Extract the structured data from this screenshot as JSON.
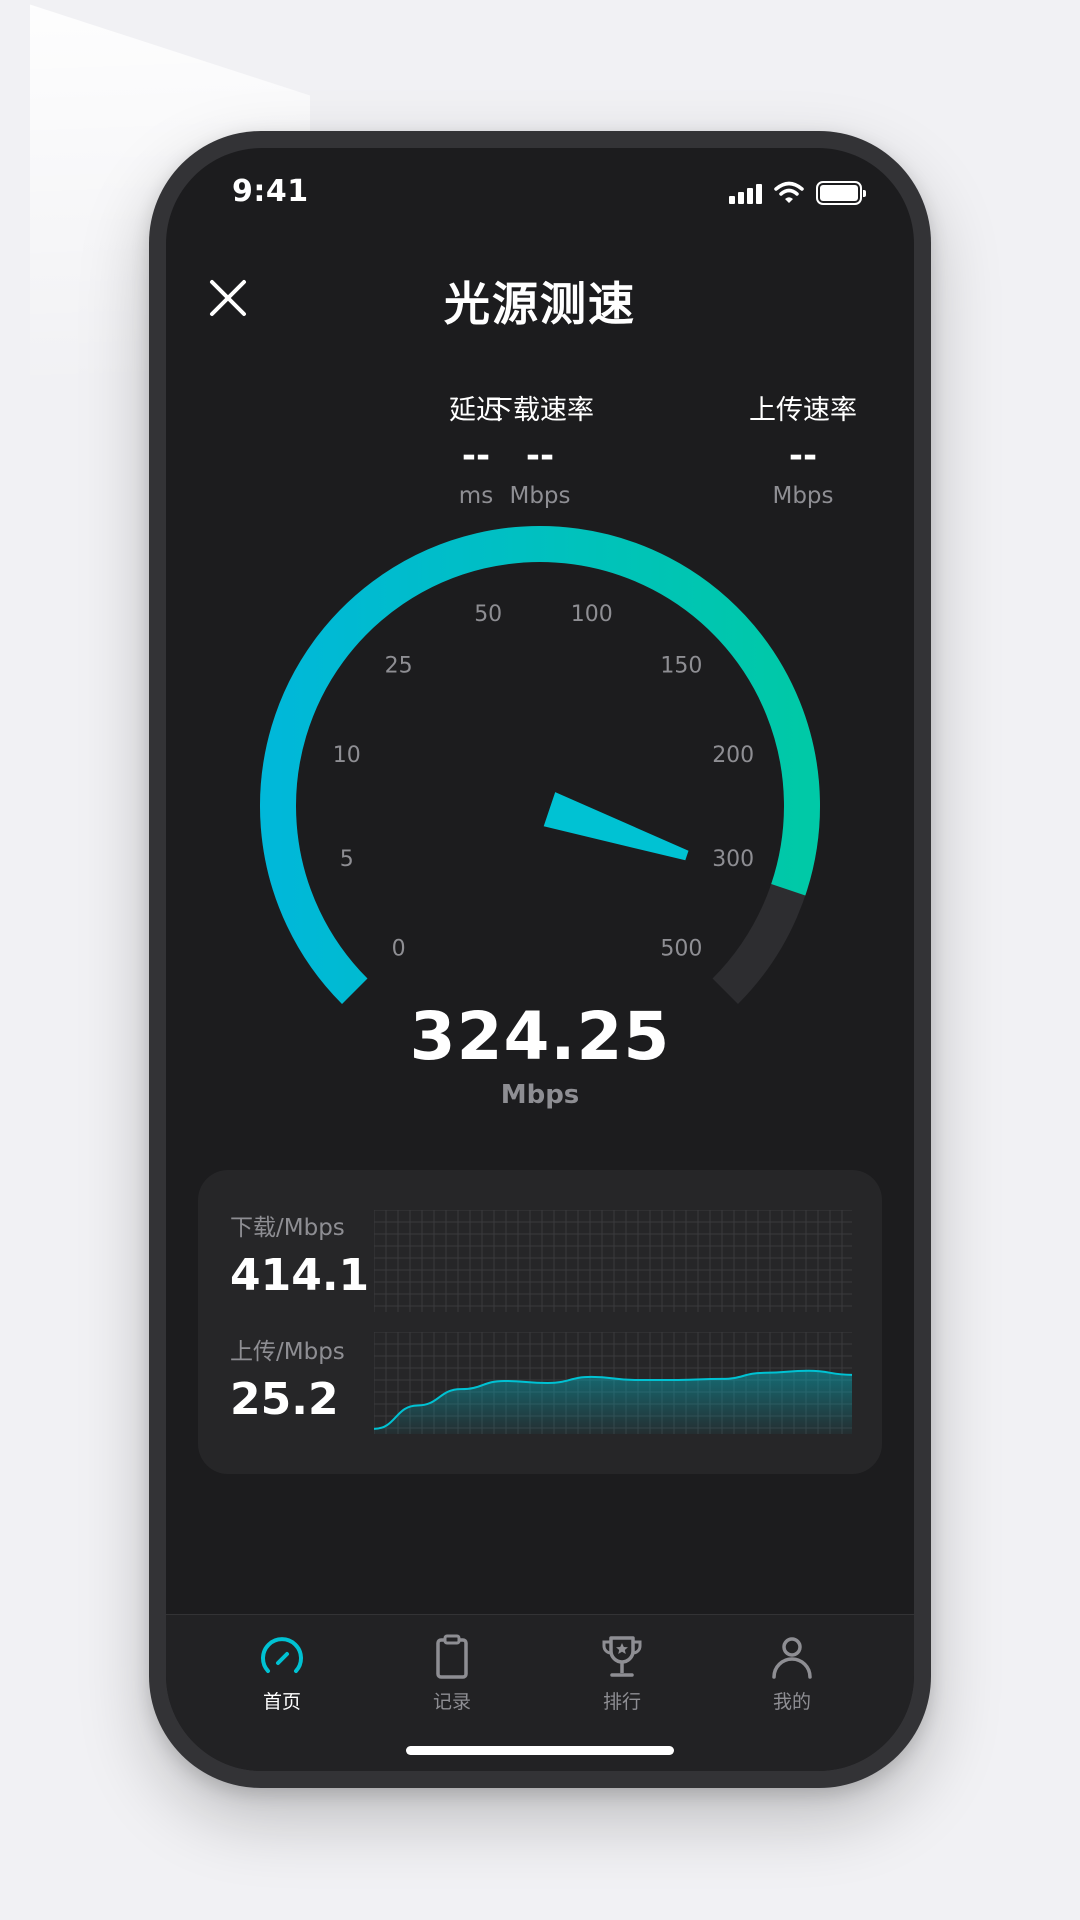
{
  "status_bar": {
    "time": "9:41"
  },
  "header": {
    "title": "光源测速",
    "close_icon": "close-icon"
  },
  "metrics": [
    {
      "label": "延迟",
      "value": "--",
      "unit": "ms"
    },
    {
      "label": "下载速率",
      "value": "--",
      "unit": "Mbps"
    },
    {
      "label": "上传速率",
      "value": "--",
      "unit": "Mbps"
    }
  ],
  "gauge": {
    "scale_labels": [
      "0",
      "5",
      "10",
      "25",
      "50",
      "100",
      "150",
      "200",
      "300",
      "500"
    ],
    "current_value": "324.25",
    "current_value_number": 324.25,
    "unit": "Mbps",
    "colors": {
      "start": "#00b8d9",
      "end": "#00c9a7",
      "track": "#2d2d30",
      "needle": "#00c2d3"
    }
  },
  "stats": {
    "download": {
      "label": "下载/Mbps",
      "value": "414.1"
    },
    "upload": {
      "label": "上传/Mbps",
      "value": "25.2"
    }
  },
  "chart_data": {
    "type": "area",
    "series": [
      {
        "values": []
      },
      {
        "values": [
          0.05,
          0.28,
          0.44,
          0.52,
          0.5,
          0.56,
          0.53,
          0.53,
          0.54,
          0.6,
          0.62,
          0.58
        ]
      }
    ]
  },
  "tabbar": {
    "items": [
      {
        "label": "首页",
        "icon": "speedometer-icon",
        "active": true
      },
      {
        "label": "记录",
        "icon": "clipboard-icon",
        "active": false
      },
      {
        "label": "排行",
        "icon": "trophy-icon",
        "active": false
      },
      {
        "label": "我的",
        "icon": "user-icon",
        "active": false
      }
    ]
  },
  "colors": {
    "accent": "#00c2d3",
    "background": "#1c1c1e",
    "card": "#262628"
  }
}
